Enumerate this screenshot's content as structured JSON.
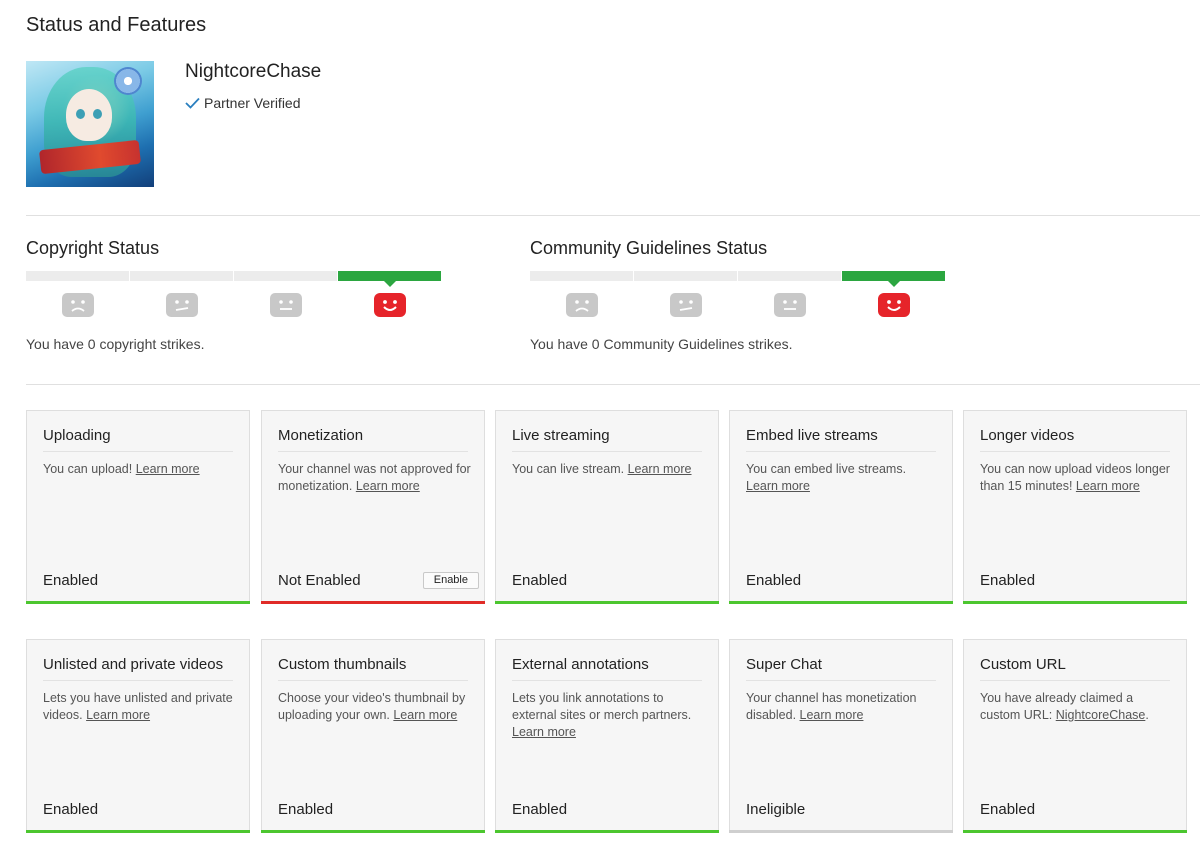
{
  "page": {
    "title": "Status and Features"
  },
  "channel": {
    "name": "NightcoreChase",
    "verified_label": "Partner Verified",
    "avatar_text": "NightcoreChase"
  },
  "colors": {
    "green": "#4cc62f",
    "red": "#e02b27",
    "grey": "#cfcfcf",
    "sad_face": "#c8c8c8",
    "happy_face": "#e6242a"
  },
  "copyright": {
    "title": "Copyright Status",
    "text": "You have 0 copyright strikes.",
    "strikes": 0
  },
  "community": {
    "title": "Community Guidelines Status",
    "text": "You have 0 Community Guidelines strikes.",
    "strikes": 0
  },
  "features": [
    {
      "title": "Uploading",
      "desc": "You can upload! ",
      "link": "Learn more",
      "desc_after": "",
      "state": "Enabled"
    },
    {
      "title": "Monetization",
      "desc": "Your channel was not approved for monetization. ",
      "link": "Learn more",
      "desc_after": "",
      "state": "Not Enabled",
      "button": "Enable"
    },
    {
      "title": "Live streaming",
      "desc": "You can live stream. ",
      "link": "Learn more",
      "desc_after": "",
      "state": "Enabled"
    },
    {
      "title": "Embed live streams",
      "desc": "You can embed live streams. ",
      "link": "Learn more",
      "desc_after": "",
      "state": "Enabled"
    },
    {
      "title": "Longer videos",
      "desc": "You can now upload videos longer than 15 minutes! ",
      "link": "Learn more",
      "desc_after": "",
      "state": "Enabled"
    },
    {
      "title": "Unlisted and private videos",
      "desc": "Lets you have unlisted and private videos. ",
      "link": "Learn more",
      "desc_after": "",
      "state": "Enabled"
    },
    {
      "title": "Custom thumbnails",
      "desc": "Choose your video's thumbnail by uploading your own. ",
      "link": "Learn more",
      "desc_after": "",
      "state": "Enabled"
    },
    {
      "title": "External annotations",
      "desc": "Lets you link annotations to external sites or merch partners. ",
      "link": "Learn more",
      "desc_after": "",
      "state": "Enabled"
    },
    {
      "title": "Super Chat",
      "desc": "Your channel has monetization disabled. ",
      "link": "Learn more",
      "desc_after": "",
      "state": "Ineligible"
    },
    {
      "title": "Custom URL",
      "desc": "You have already claimed a custom URL: ",
      "link": "NightcoreChase",
      "desc_after": ".",
      "state": "Enabled"
    }
  ]
}
